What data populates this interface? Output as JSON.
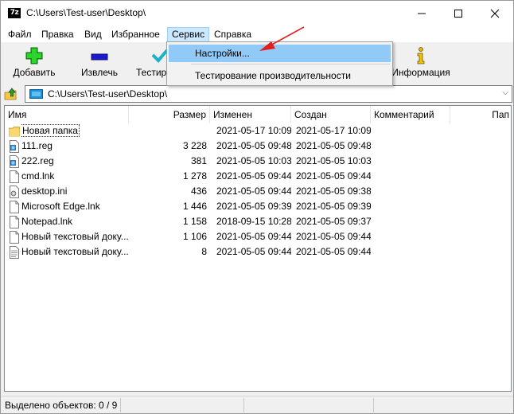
{
  "window": {
    "title": "C:\\Users\\Test-user\\Desktop\\",
    "app_icon_text": "7z"
  },
  "menubar": {
    "items": [
      "Файл",
      "Правка",
      "Вид",
      "Избранное",
      "Сервис",
      "Справка"
    ],
    "active": "Сервис"
  },
  "toolbar": {
    "add_label": "Добавить",
    "extract_label": "Извлечь",
    "test_label": "Тестир",
    "info_label": "Информация",
    "add_icon": "plus-icon",
    "extract_icon": "minus-icon",
    "test_icon": "check-icon",
    "info_icon": "info-icon"
  },
  "address": {
    "path": "C:\\Users\\Test-user\\Desktop\\"
  },
  "columns": [
    "Имя",
    "Размер",
    "Изменен",
    "Создан",
    "Комментарий",
    "Пап"
  ],
  "files": [
    {
      "name": "Новая папка",
      "size": "",
      "modified": "2021-05-17 10:09",
      "created": "2021-05-17 10:09",
      "type": "folder"
    },
    {
      "name": "111.reg",
      "size": "3 228",
      "modified": "2021-05-05 09:48",
      "created": "2021-05-05 09:48",
      "type": "reg"
    },
    {
      "name": "222.reg",
      "size": "381",
      "modified": "2021-05-05 10:03",
      "created": "2021-05-05 10:03",
      "type": "reg"
    },
    {
      "name": "cmd.lnk",
      "size": "1 278",
      "modified": "2021-05-05 09:44",
      "created": "2021-05-05 09:44",
      "type": "file"
    },
    {
      "name": "desktop.ini",
      "size": "436",
      "modified": "2021-05-05 09:44",
      "created": "2021-05-05 09:38",
      "type": "ini"
    },
    {
      "name": "Microsoft Edge.lnk",
      "size": "1 446",
      "modified": "2021-05-05 09:39",
      "created": "2021-05-05 09:39",
      "type": "file"
    },
    {
      "name": "Notepad.lnk",
      "size": "1 158",
      "modified": "2018-09-15 10:28",
      "created": "2021-05-05 09:37",
      "type": "file"
    },
    {
      "name": "Новый текстовый доку...",
      "size": "1 106",
      "modified": "2021-05-05 09:44",
      "created": "2021-05-05 09:44",
      "type": "file"
    },
    {
      "name": "Новый текстовый доку...",
      "size": "8",
      "modified": "2021-05-05 09:44",
      "created": "2021-05-05 09:44",
      "type": "text"
    }
  ],
  "dropdown": {
    "items": [
      "Настройки...",
      "Тестирование производительности"
    ],
    "highlighted": "Настройки..."
  },
  "status": {
    "selected": "Выделено объектов: 0 / 9"
  },
  "colors": {
    "menu_highlight": "#91c9f7",
    "annotation_arrow": "#e02020"
  }
}
